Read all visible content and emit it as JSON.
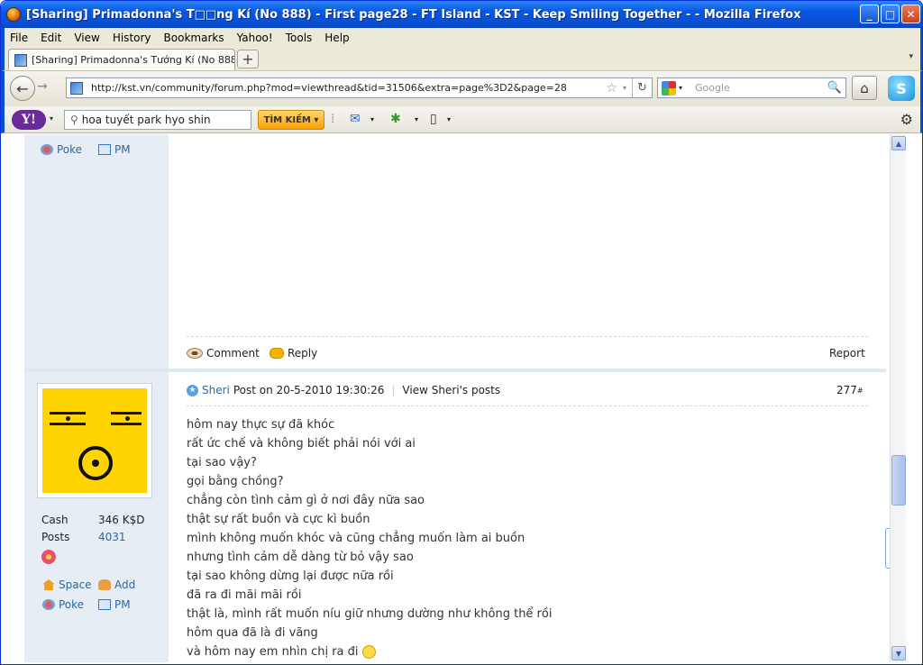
{
  "window": {
    "title": "[Sharing] Primadonna's T□□ng Kí (No 888) - First page28 - FT Island - KST - Keep Smiling Together - - Mozilla Firefox",
    "buttons": {
      "min": "_",
      "max": "□",
      "close": "✕"
    }
  },
  "menu": [
    "File",
    "Edit",
    "View",
    "History",
    "Bookmarks",
    "Yahoo!",
    "Tools",
    "Help"
  ],
  "tab": {
    "label": "[Sharing] Primadonna's Tướng Kí (No 888) - ...",
    "new_tab": "+"
  },
  "nav": {
    "url": "http://kst.vn/community/forum.php?mod=viewthread&tid=31506&extra=page%3D2&page=28",
    "search_placeholder": "Google"
  },
  "yahoo": {
    "logo": "Y!",
    "search_value": "hoa tuyết park hyo shin",
    "search_button": "TÌM KIẾM ▾"
  },
  "top_post": {
    "user_links": {
      "poke": "Poke",
      "pm": "PM"
    },
    "actions": {
      "comment": "Comment",
      "reply": "Reply",
      "report": "Report"
    }
  },
  "post": {
    "author": "Sheri",
    "post_on": "Post on 20-5-2010 19:30:26",
    "view_posts": "View Sheri's posts",
    "number": "277",
    "number_suffix": "#",
    "lines": [
      "hôm nay thực sự đã khóc",
      "rất ức chế và không biết phải nói với ai",
      "tại sao vậy?",
      "gọi bằng chồng?",
      "chẳng còn tình cảm gì ở nơi đây nữa sao",
      "thật sự rất buồn và cực kì buồn",
      "mình không muốn khóc và cũng chẳng muốn làm ai buồn",
      "nhưng tình cảm dễ dàng từ bỏ vậy sao",
      "tại sao không dừng lại được nữa rồi",
      "đã ra đi mãi mãi rồi",
      "thật là, mình rất muốn níu giữ nhưng dường như không thể rồi",
      "hôm qua đã là đi vãng",
      "và hôm nay em nhìn chị ra đi"
    ]
  },
  "sidebar": {
    "cash_label": "Cash",
    "cash_value": "346 K$D",
    "posts_label": "Posts",
    "posts_value": "4031",
    "space": "Space",
    "add": "Add",
    "poke": "Poke",
    "pm": "PM"
  },
  "scroll_widget": "UP"
}
